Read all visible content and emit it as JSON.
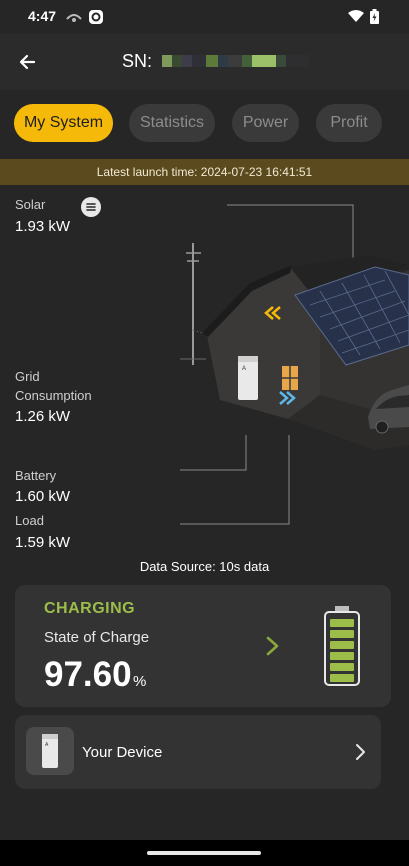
{
  "status_bar": {
    "time": "4:47"
  },
  "app_bar": {
    "title_prefix": "SN:"
  },
  "tabs": [
    {
      "label": "My System",
      "active": true
    },
    {
      "label": "Statistics",
      "active": false
    },
    {
      "label": "Power",
      "active": false
    },
    {
      "label": "Profit",
      "active": false
    }
  ],
  "launch_banner": "Latest launch time: 2024-07-23 16:41:51",
  "energy": {
    "solar": {
      "label": "Solar",
      "value": "1.93 kW"
    },
    "grid": {
      "label_line1": "Grid",
      "label_line2": "Consumption",
      "value": "1.26 kW"
    },
    "battery": {
      "label": "Battery",
      "value": "1.60 kW"
    },
    "load": {
      "label": "Load",
      "value": "1.59 kW"
    }
  },
  "data_source": "Data Source: 10s data",
  "charging_card": {
    "status": "CHARGING",
    "label": "State of Charge",
    "value": "97.60",
    "unit": "%",
    "soc_fraction": 0.976
  },
  "device_card": {
    "label": "Your Device"
  },
  "colors": {
    "accent": "#f5b90a",
    "charging_green": "#9dbd4b",
    "background": "#262626",
    "card": "#333333"
  },
  "icons": [
    "wifi-icon",
    "battery-status-icon",
    "back-arrow-icon",
    "menu-icon",
    "chevron-right-icon",
    "battery-gauge-icon",
    "device-icon"
  ]
}
